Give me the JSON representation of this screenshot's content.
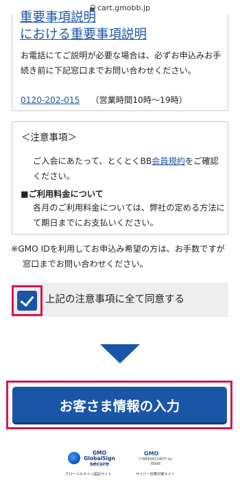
{
  "browser": {
    "url": "cart.gmobb.jp"
  },
  "important_info": {
    "heading_cut": "重要事項説明",
    "heading": "における重要事項説明",
    "body": "お電話にてご説明が必要な場合は、必ずお申込みお手続き前に下記窓口までお問い合わせください。",
    "phone": "0120-202-015",
    "hours": "（営業時間10時～19時）"
  },
  "notice": {
    "title": "＜注意事項＞",
    "para_before": "ご入会にあたって、とくとくBB",
    "link": "会員規約",
    "para_after": "をご確認ください。",
    "fee_title": "■ご利用料金について",
    "fee_text": "各月のご利用料金については、弊社の定める方法にて期日までにお支払いください。"
  },
  "gmo_note": "※GMO IDを利用してお申込み希望の方は、お手数ですが窓口までお問い合わせください。",
  "agree": {
    "label": "上記の注意事項に全て同意する",
    "checked": true
  },
  "submit": {
    "label": "お客さま情報の入力"
  },
  "badges": {
    "globalsign_top": "GMO",
    "globalsign_name": "GlobalSign",
    "globalsign_secure": "secure",
    "globalsign_caption": "グローバルサイン認証サイト",
    "cyber_top": "GMO",
    "cyber_mid": "CYBERSECURITY by IERAE",
    "cyber_caption": "サイバー攻撃対策サイト"
  },
  "colors": {
    "brand_blue": "#1a55a8",
    "highlight_red": "#d8154f"
  },
  "icons": [
    "lock-icon",
    "checkmark-icon",
    "arrow-down-icon",
    "globalsign-logo",
    "cybersecurity-logo"
  ]
}
